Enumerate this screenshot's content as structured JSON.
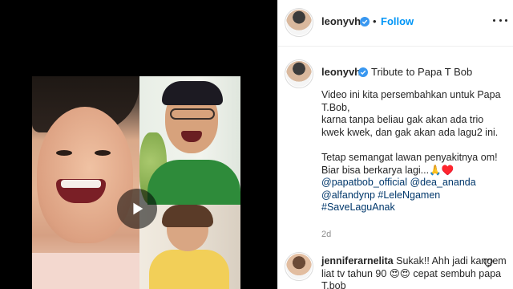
{
  "header": {
    "username": "leonyvh",
    "separator": "•",
    "follow_label": "Follow"
  },
  "caption": {
    "username": "leonyvh",
    "title": "Tribute to Papa T Bob",
    "lines": [
      "Video ini kita persembahkan untuk Papa T.Bob,",
      "karna tanpa beliau gak akan ada trio kwek kwek, dan gak akan ada lagu2 ini.",
      "Tetap semangat lawan penyakitnya om! Biar bisa berkarya lagi...🙏♥️"
    ],
    "tags": [
      "@papatbob_official",
      "@dea_ananda",
      "@alfandynp",
      "#LeleNgamen",
      "#SaveLaguAnak"
    ],
    "age": "2d"
  },
  "comment": {
    "username": "jenniferarnelita",
    "text": "Sukak!! Ahh jadi kangem liat tv tahun 90 😍😍 cepat sembuh papa T.bob"
  },
  "colors": {
    "link_blue": "#0095f6",
    "tag_blue": "#00376b",
    "verified_blue": "#3897f0",
    "muted": "#8e8e8e"
  },
  "icons": [
    "play-icon",
    "verified-badge-icon",
    "more-options-icon",
    "heart-icon"
  ]
}
